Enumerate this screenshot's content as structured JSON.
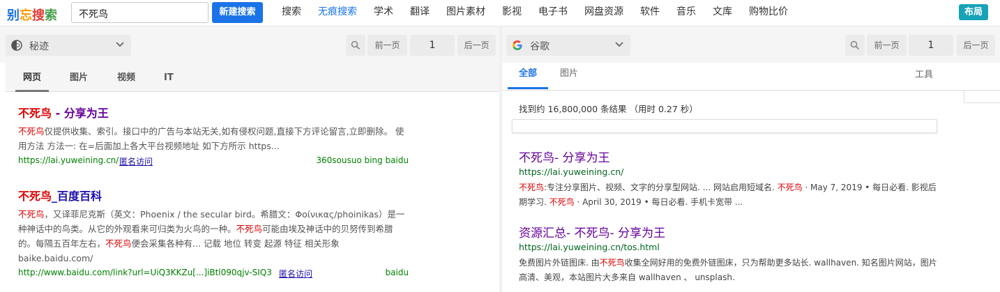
{
  "logo": [
    "别",
    "忘",
    "搜",
    "索"
  ],
  "search": {
    "query": "不死鸟",
    "button": "新建搜索"
  },
  "nav": [
    "搜索",
    "无痕搜索",
    "学术",
    "翻译",
    "图片素材",
    "影视",
    "电子书",
    "网盘资源",
    "软件",
    "音乐",
    "文库",
    "购物比价"
  ],
  "nav_active_index": 1,
  "layout_button": "布局",
  "left": {
    "engine": "秘迹",
    "prev": "前一页",
    "page": "1",
    "next": "后一页",
    "tabs": [
      "网页",
      "图片",
      "视频",
      "IT"
    ],
    "results": [
      {
        "title_hl": "不死鸟",
        "title_rest": " - 分享为王",
        "desc_parts": [
          {
            "t": "不死鸟",
            "hl": true
          },
          {
            "t": "仅提供收集、索引。接口中的广告与本站无关,如有侵权问题,直接下方评论留言,立即删除。 使用方法 方法一: 在=后面加上各大平台视频地址 如下方所示 https...",
            "hl": false
          }
        ],
        "url": "https://lai.yuweining.cn/",
        "anon": "匿名访问",
        "sources": "360sousuo bing baidu"
      },
      {
        "title_hl": "不死鸟",
        "title_rest": "_百度百科",
        "desc_parts": [
          {
            "t": "不死鸟",
            "hl": true
          },
          {
            "t": "，又译菲尼克斯（英文：Phoenix / the secular bird。希腊文：Φοίνικας/phoinikas）是一种神话中的鸟类。从它的外观看来可归类为火鸟的一种。",
            "hl": false
          },
          {
            "t": "不死鸟",
            "hl": true
          },
          {
            "t": "可能由埃及神话中的贝努传到希腊的。每隔五百年左右，",
            "hl": false
          },
          {
            "t": "不死鸟",
            "hl": true
          },
          {
            "t": "便会采集各种有... 记载 地位 转变 起源 特征 相关形象 baike.baidu.com/",
            "hl": false
          }
        ],
        "url": "http://www.baidu.com/link?url=UiQ3KKZu[...]iBtl090qjv-SIQ3...",
        "anon": "匿名访问",
        "sources": "baidu"
      }
    ]
  },
  "right": {
    "engine": "谷歌",
    "prev": "前一页",
    "page": "1",
    "next": "后一页",
    "tabs": [
      "全部",
      "图片"
    ],
    "tools": "工具",
    "count": "找到约 16,800,000 条结果  （用时 0.27 秒）",
    "results": [
      {
        "title": "不死鸟- 分享为王",
        "url": "https://lai.yuweining.cn/",
        "desc_parts": [
          {
            "t": "不死鸟",
            "hl": true
          },
          {
            "t": ":专注分享图片、视频、文字的分享型网站. ... 网站启用短域名. ",
            "hl": false
          },
          {
            "t": "不死鸟",
            "hl": true
          },
          {
            "t": " · May 7, 2019 • 每日必看. 影视后期学习. ",
            "hl": false
          },
          {
            "t": "不死鸟",
            "hl": true
          },
          {
            "t": " · April 30, 2019 • 每日必看. 手机卡宽带 ...",
            "hl": false
          }
        ]
      },
      {
        "title": "资源汇总- 不死鸟- 分享为王",
        "url": "https://lai.yuweining.cn/tos.html",
        "desc_parts": [
          {
            "t": "免费图片外链图床. 由",
            "hl": false
          },
          {
            "t": "不死鸟",
            "hl": true
          },
          {
            "t": "收集全网好用的免费外链图床，只为帮助更多站长. wallhaven. 知名图片网站，图片高清、美观，本站图片大多来自 wallhaven 、 unsplash.",
            "hl": false
          }
        ]
      }
    ]
  },
  "colors": {
    "accent": "#1a73e8",
    "highlight": "#e00000",
    "visited": "#660099",
    "url": "#008000",
    "layout_btn": "#17a2b8"
  },
  "icons": {
    "left_engine": "mijisou-icon",
    "right_engine": "google-icon",
    "search": "magnifier-icon",
    "dropdown": "chevron-down-icon"
  }
}
